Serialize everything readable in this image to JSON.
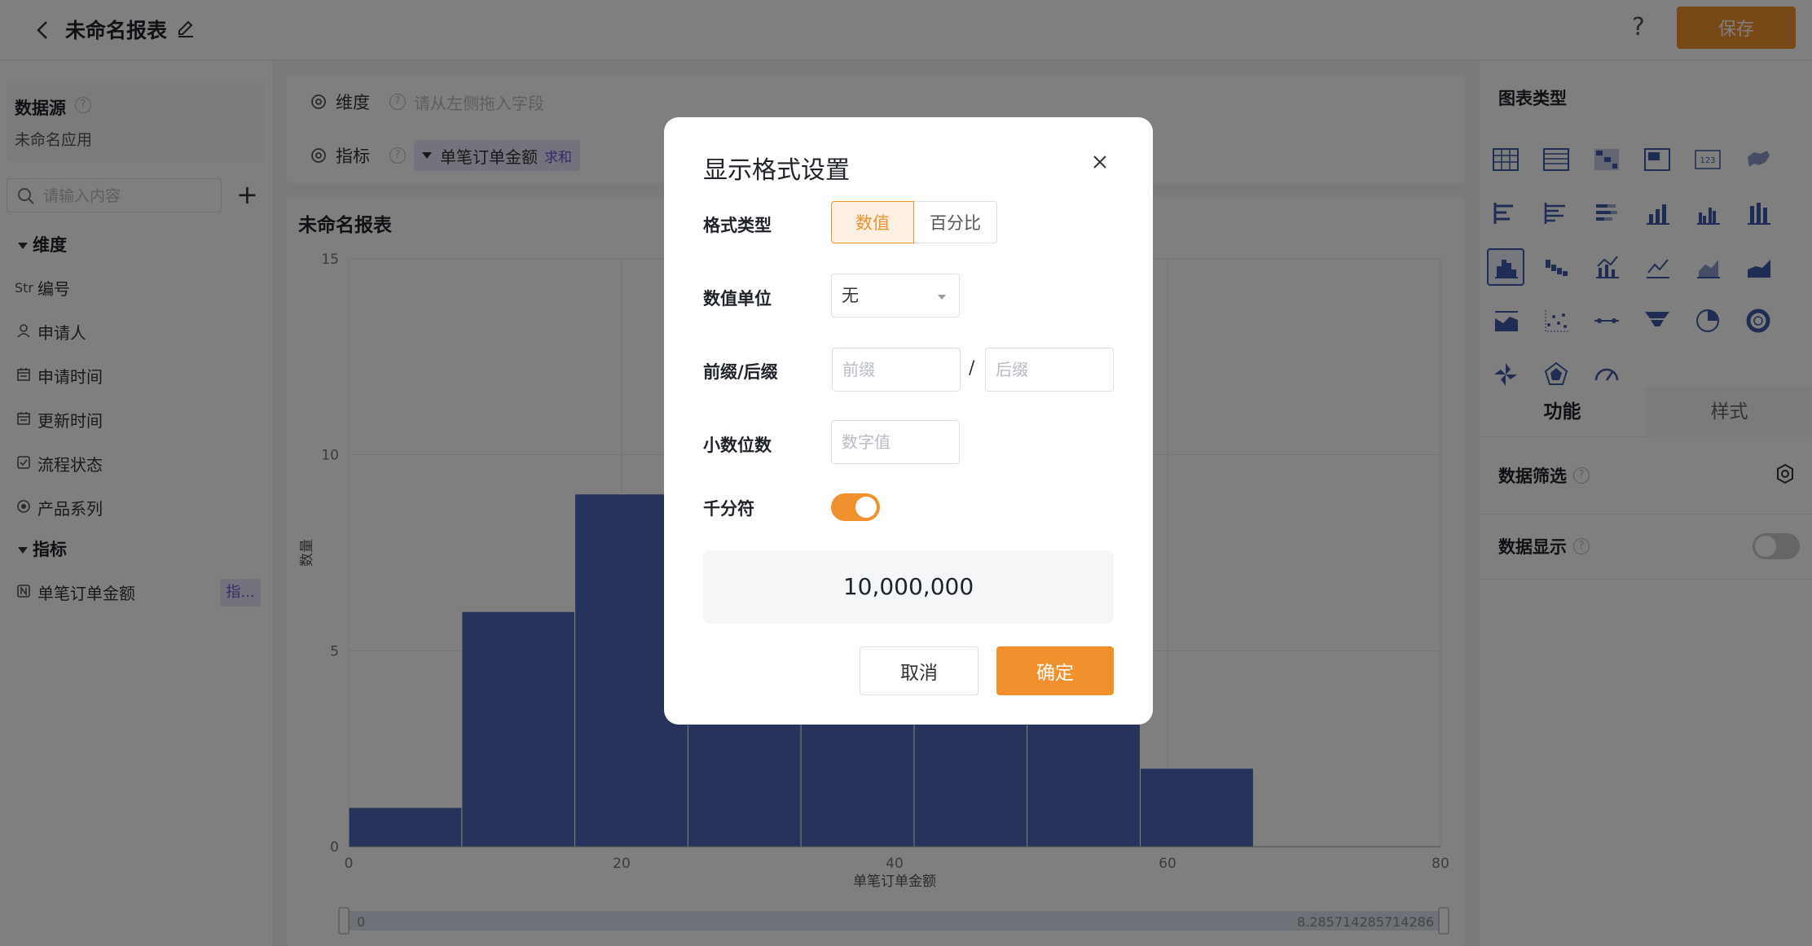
{
  "header": {
    "title": "未命名报表",
    "help": "?",
    "save_label": "保存"
  },
  "left_panel": {
    "datasource_title": "数据源",
    "datasource_name": "未命名应用",
    "search_placeholder": "请输入内容",
    "dimensions_head": "维度",
    "dimensions": [
      {
        "icon": "Str",
        "label": "编号"
      },
      {
        "icon": "user-icon",
        "label": "申请人"
      },
      {
        "icon": "calendar-icon",
        "label": "申请时间"
      },
      {
        "icon": "calendar-icon",
        "label": "更新时间"
      },
      {
        "icon": "checkbox-icon",
        "label": "流程状态"
      },
      {
        "icon": "radio-icon",
        "label": "产品系列"
      }
    ],
    "metrics_head": "指标",
    "metrics": [
      {
        "icon": "number-icon",
        "label": "单笔订单金额",
        "badge": "指..."
      }
    ]
  },
  "field_bar": {
    "dimension_label": "维度",
    "dimension_placeholder": "请从左侧拖入字段",
    "metric_label": "指标",
    "metric_chip": "单笔订单金额",
    "metric_agg": "求和"
  },
  "chart_title": "未命名报表",
  "chart_data": {
    "type": "bar",
    "title": "未命名报表",
    "xlabel": "单笔订单金额",
    "ylabel": "数量",
    "x_bins": [
      [
        0,
        8.29
      ],
      [
        8.29,
        16.57
      ],
      [
        16.57,
        24.86
      ],
      [
        24.86,
        33.14
      ],
      [
        33.14,
        41.43
      ],
      [
        41.43,
        49.71
      ],
      [
        49.71,
        58.0
      ],
      [
        58.0,
        66.29
      ]
    ],
    "values": [
      1,
      6,
      9,
      9,
      9,
      9,
      9,
      2
    ],
    "xlim": [
      0,
      80
    ],
    "ylim": [
      0,
      15
    ],
    "x_ticks": [
      "0",
      "20",
      "40",
      "60",
      "80"
    ],
    "y_ticks": [
      "0",
      "5",
      "10",
      "15"
    ],
    "slider_min": "0",
    "slider_max": "8.285714285714286",
    "bar_color": "#4d68b8",
    "grid": true
  },
  "right_panel": {
    "chart_type_title": "图表类型",
    "tab_function": "功能",
    "tab_style": "样式",
    "data_filter": "数据筛选",
    "data_display": "数据显示"
  },
  "modal": {
    "title": "显示格式设置",
    "format_type_label": "格式类型",
    "format_numeric": "数值",
    "format_percent": "百分比",
    "unit_label": "数值单位",
    "unit_value": "无",
    "affix_label": "前缀/后缀",
    "prefix_placeholder": "前缀",
    "slash": "/",
    "suffix_placeholder": "后缀",
    "decimal_label": "小数位数",
    "decimal_placeholder": "数字值",
    "thousands_label": "千分符",
    "thousands_enabled": true,
    "preview": "10,000,000",
    "cancel_label": "取消",
    "confirm_label": "确定"
  },
  "colors": {
    "accent": "#f0912d",
    "bar": "#4d68b8",
    "metric_chip": "#e8e4fb"
  }
}
